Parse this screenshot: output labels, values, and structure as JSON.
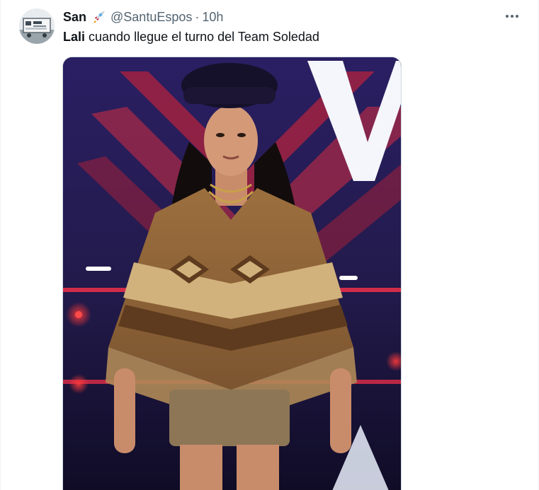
{
  "tweet": {
    "author_name": "San",
    "author_emoji_icon": "rocket-icon",
    "handle": "@SantuEspos",
    "separator": "·",
    "timestamp": "10h",
    "more_icon": "more-icon",
    "text_mention": "Lali",
    "text_body": " cuando llegue el turno del Team Soledad"
  },
  "colors": {
    "text_primary": "#0f1419",
    "text_secondary": "#536471",
    "border": "#cfd9de"
  }
}
